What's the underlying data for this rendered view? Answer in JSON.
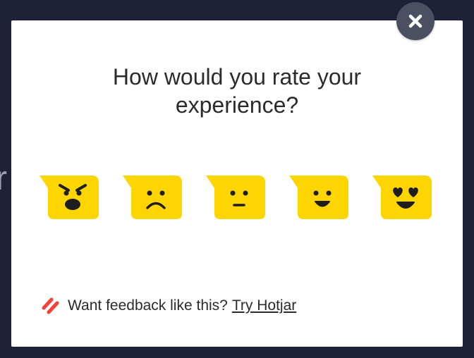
{
  "background": {
    "fragment": "r"
  },
  "survey": {
    "question_line1": "How would you rate your",
    "question_line2": "experience?",
    "ratings": [
      {
        "name": "angry",
        "icon": "angry-face-icon"
      },
      {
        "name": "sad",
        "icon": "sad-face-icon"
      },
      {
        "name": "neutral",
        "icon": "neutral-face-icon"
      },
      {
        "name": "happy",
        "icon": "happy-face-icon"
      },
      {
        "name": "love",
        "icon": "heart-eyes-face-icon"
      }
    ],
    "close_icon": "close-icon"
  },
  "footer": {
    "prompt": "Want feedback like this?",
    "cta": "Try Hotjar",
    "logo_icon": "hotjar-logo-icon"
  },
  "colors": {
    "backdrop": "#1d2238",
    "modal": "#ffffff",
    "emoji_yellow": "#ffd500",
    "face_feature": "#1e1e1e",
    "close_button": "#4b4f61",
    "logo_red": "#f3413a"
  }
}
